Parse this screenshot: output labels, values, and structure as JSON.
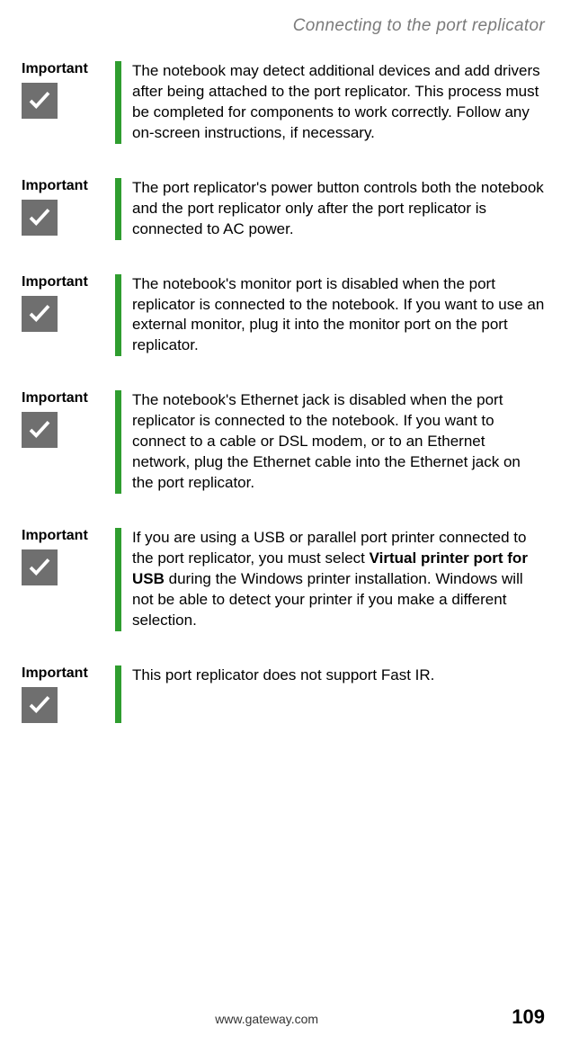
{
  "header": {
    "title": "Connecting to the port replicator"
  },
  "callouts": [
    {
      "label": "Important",
      "body": "The notebook may detect additional devices and add drivers after being attached to the port replicator. This process must be completed for components to work correctly. Follow any on-screen instructions, if necessary."
    },
    {
      "label": "Important",
      "body": "The port replicator's power button controls both the notebook and the port replicator only after the port replicator is connected to AC power."
    },
    {
      "label": "Important",
      "body": "The notebook's monitor port is disabled when the port replicator is connected to the notebook. If you want to use an external monitor, plug it into the monitor port on the port replicator."
    },
    {
      "label": "Important",
      "body": "The notebook's Ethernet jack is disabled when the port replicator is connected to the notebook. If you want to connect to a cable or DSL modem, or to an Ethernet network, plug the Ethernet cable into the Ethernet jack on the port replicator."
    },
    {
      "label": "Important",
      "body_parts": [
        {
          "text": "If you are using a USB or parallel port printer connected to the port replicator, you must select ",
          "bold": false
        },
        {
          "text": "Virtual printer port for USB",
          "bold": true
        },
        {
          "text": " during the Windows printer installation. Windows will not be able to detect your printer if you make a different selection.",
          "bold": false
        }
      ]
    },
    {
      "label": "Important",
      "body": "This port replicator does not support Fast IR."
    }
  ],
  "footer": {
    "url": "www.gateway.com",
    "page": "109"
  }
}
